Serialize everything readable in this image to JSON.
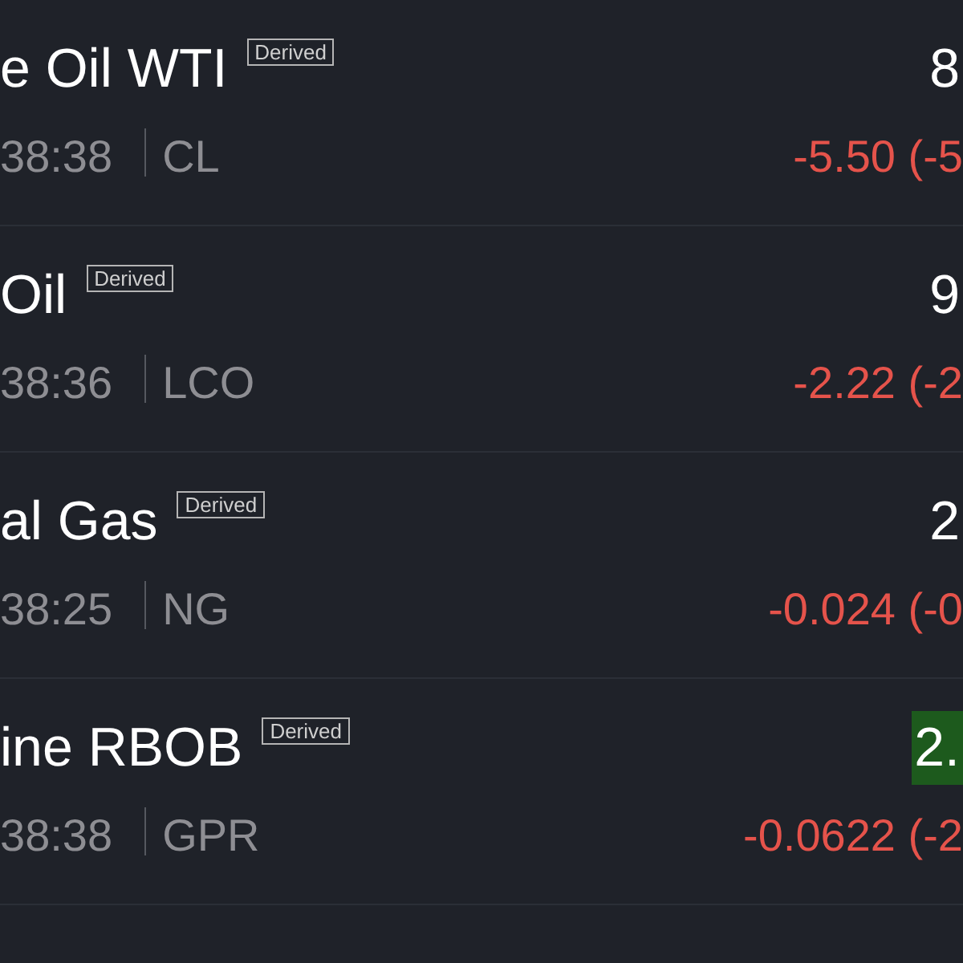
{
  "quotes": [
    {
      "name": "e Oil WTI",
      "badge": "Derived",
      "price": "8",
      "price_highlight": false,
      "time": "38:38",
      "ticker": "CL",
      "change": "-5.50 (-5",
      "color": "#e5534b"
    },
    {
      "name": "Oil",
      "badge": "Derived",
      "price": "9",
      "price_highlight": false,
      "time": "38:36",
      "ticker": "LCO",
      "change": "-2.22 (-2",
      "color": "#e5534b"
    },
    {
      "name": "al Gas",
      "badge": "Derived",
      "price": "2",
      "price_highlight": false,
      "time": "38:25",
      "ticker": "NG",
      "change": "-0.024 (-0",
      "color": "#e5534b"
    },
    {
      "name": "ine RBOB",
      "badge": "Derived",
      "price": "2.",
      "price_highlight": true,
      "time": "38:38",
      "ticker": "GPR",
      "change": "-0.0622 (-2",
      "color": "#e5534b"
    }
  ]
}
